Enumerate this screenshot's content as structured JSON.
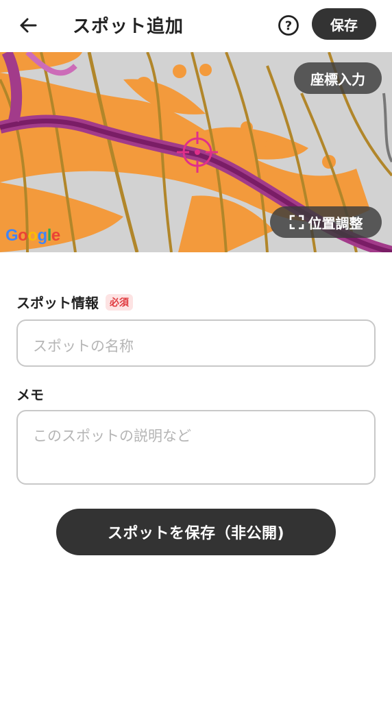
{
  "header": {
    "title": "スポット追加",
    "back_icon": "back-arrow-icon",
    "help_icon": "help-circle-icon",
    "save_label": "保存"
  },
  "map": {
    "coord_input_label": "座標入力",
    "adjust_label": "位置調整",
    "adjust_icon": "expand-frame-icon",
    "crosshair_icon": "crosshair-icon",
    "crosshair_color": "#e0308a",
    "attribution": [
      "G",
      "o",
      "o",
      "g",
      "l",
      "e"
    ],
    "attribution_colors": [
      "#4285F4",
      "#EA4335",
      "#FBBC05",
      "#4285F4",
      "#34A853",
      "#EA4335"
    ]
  },
  "form": {
    "spot_info_label": "スポット情報",
    "required_badge": "必須",
    "spot_name_placeholder": "スポットの名称",
    "memo_label": "メモ",
    "memo_placeholder": "このスポットの説明など"
  },
  "primary_action": {
    "label": "スポットを保存（非公開)"
  }
}
